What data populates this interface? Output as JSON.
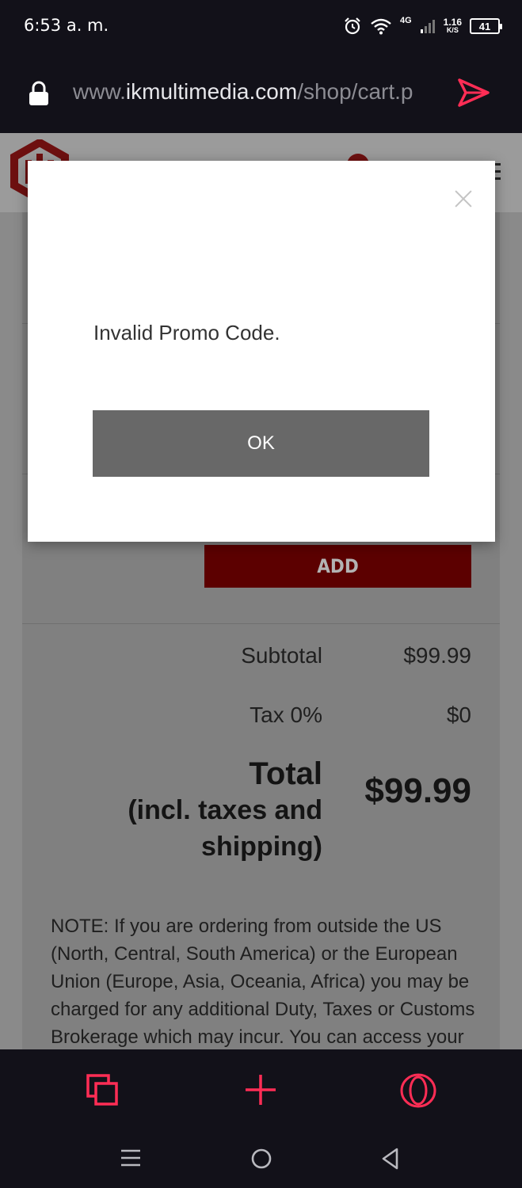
{
  "status_bar": {
    "time": "6:53 a. m.",
    "network": "4G",
    "speed_value": "1.16",
    "speed_unit": "K/S",
    "battery": "41"
  },
  "browser": {
    "url_prefix": "www.",
    "url_host": "ikmultimedia.com",
    "url_path": "/shop/cart.p"
  },
  "cart": {
    "add_label": "ADD",
    "subtotal_label": "Subtotal",
    "subtotal_value": "$99.99",
    "tax_label": "Tax 0%",
    "tax_value": "$0",
    "total_label": "Total",
    "total_sublabel": "(incl. taxes and shipping)",
    "total_value": "$99.99",
    "note": "NOTE: If you are ordering from outside the US (North, Central, South America) or the European Union (Europe, Asia, Oceania, Africa) you may be charged for any additional Duty, Taxes or Customs Brokerage which may incur. You can access your"
  },
  "modal": {
    "message": "Invalid Promo Code.",
    "ok_label": "OK"
  },
  "colors": {
    "accent": "#ff2d55",
    "brand_red": "#6e1010"
  }
}
